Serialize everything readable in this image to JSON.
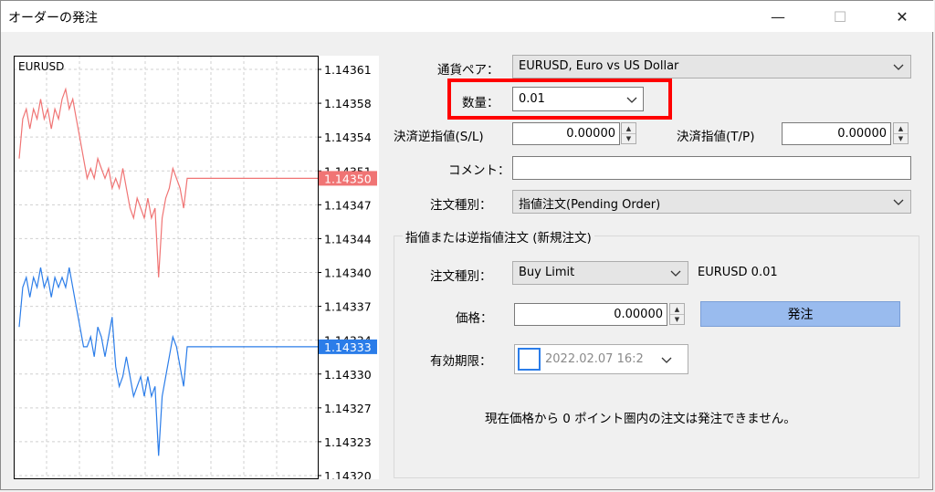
{
  "window": {
    "title": "オーダーの発注",
    "minimize": "—",
    "maximize": "☐",
    "close": "✕"
  },
  "chart": {
    "symbol": "EURUSD",
    "y_ticks": [
      "1.14361",
      "1.14358",
      "1.14354",
      "1.14351",
      "1.14347",
      "1.14344",
      "1.14340",
      "1.14337",
      "1.14334",
      "1.14330",
      "1.14327",
      "1.14323",
      "1.14320"
    ],
    "bid_tag": "1.14350",
    "ask_tag": "1.14333",
    "colors": {
      "bid": "#f07474",
      "ask": "#2b7de9",
      "grid": "#d0d0d0"
    }
  },
  "chart_data": {
    "type": "line",
    "ylim": [
      1.1432,
      1.14361
    ],
    "series": [
      {
        "name": "Bid",
        "values": [
          1.14352,
          1.14356,
          1.14357,
          1.14355,
          1.14357,
          1.14356,
          1.14358,
          1.14356,
          1.14357,
          1.14355,
          1.14357,
          1.14356,
          1.14358,
          1.14359,
          1.14357,
          1.14358,
          1.14356,
          1.14354,
          1.14352,
          1.1435,
          1.14351,
          1.1435,
          1.14352,
          1.14351,
          1.1435,
          1.14351,
          1.14349,
          1.1435,
          1.14349,
          1.14351,
          1.14349,
          1.14347,
          1.14346,
          1.14348,
          1.14347,
          1.14346,
          1.14348,
          1.14346,
          1.14347,
          1.1434,
          1.14346,
          1.14348,
          1.14349,
          1.14351,
          1.1435,
          1.14349,
          1.14347,
          1.1435
        ]
      },
      {
        "name": "Ask",
        "values": [
          1.14335,
          1.14339,
          1.1434,
          1.14338,
          1.1434,
          1.14339,
          1.14341,
          1.14339,
          1.1434,
          1.14338,
          1.1434,
          1.14339,
          1.1434,
          1.14339,
          1.14341,
          1.14339,
          1.14337,
          1.14335,
          1.14333,
          1.14333,
          1.14334,
          1.14332,
          1.14335,
          1.14334,
          1.14332,
          1.14334,
          1.14336,
          1.14331,
          1.14329,
          1.1433,
          1.14332,
          1.1433,
          1.14328,
          1.14329,
          1.1433,
          1.14328,
          1.1433,
          1.14328,
          1.14329,
          1.14322,
          1.14328,
          1.1433,
          1.14332,
          1.14334,
          1.14333,
          1.14331,
          1.14329,
          1.14333
        ]
      }
    ]
  },
  "form": {
    "pair_label": "通貨ペア：",
    "pair_value": "EURUSD, Euro vs US Dollar",
    "volume_label": "数量：",
    "volume_value": "0.01",
    "sl_label": "決済逆指値(S/L)",
    "sl_value": "0.00000",
    "tp_label": "決済指値(T/P)",
    "tp_value": "0.00000",
    "comment_label": "コメント：",
    "comment_value": "",
    "order_type_label": "注文種別：",
    "order_type_value": "指値注文(Pending Order)"
  },
  "pending": {
    "group_title": "指値または逆指値注文 (新規注文)",
    "type_label": "注文種別：",
    "type_value": "Buy Limit",
    "symbol_info": "EURUSD 0.01",
    "price_label": "価格：",
    "price_value": "0.00000",
    "place_button": "発注",
    "expiry_label": "有効期限：",
    "expiry_value": "2022.02.07 16:2",
    "note": "現在価格から 0 ポイント圏内の注文は発注できません。"
  }
}
